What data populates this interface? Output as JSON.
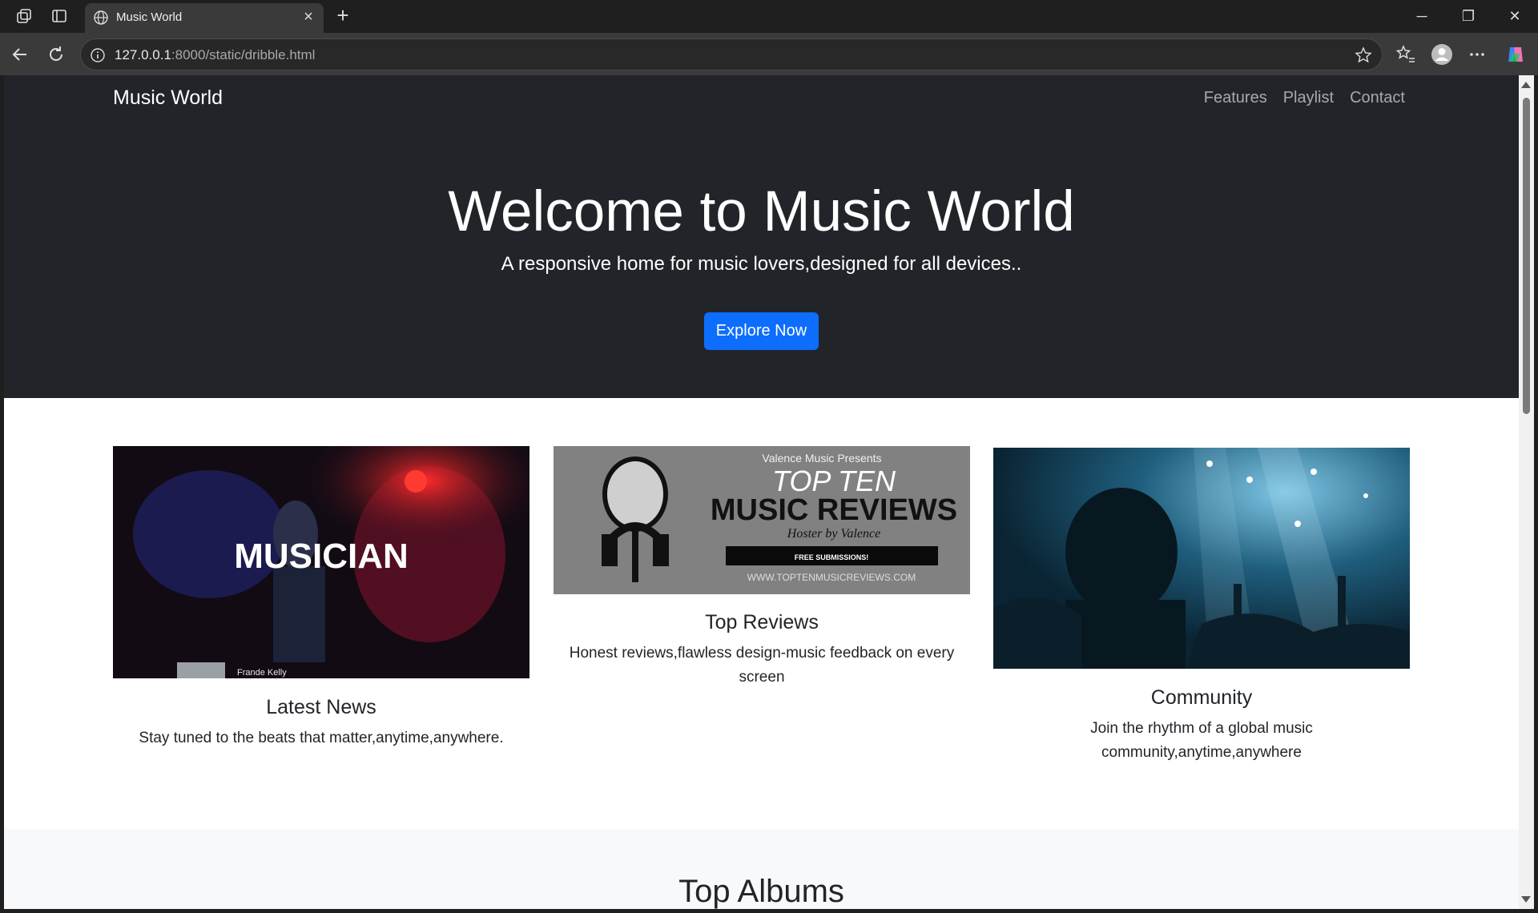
{
  "browser": {
    "tab_title": "Music World",
    "url_host": "127.0.0.1",
    "url_rest": ":8000/static/dribble.html"
  },
  "navbar": {
    "brand": "Music World",
    "links": [
      "Features",
      "Playlist",
      "Contact"
    ]
  },
  "hero": {
    "title": "Welcome to Music World",
    "subtitle": "A responsive home for music lovers,designed for all devices..",
    "cta": "Explore Now"
  },
  "cards": [
    {
      "title": "Latest News",
      "text": "Stay tuned to the beats that matter,anytime,anywhere.",
      "image_text": "MUSICIAN",
      "image_caption": "Frande Kelly"
    },
    {
      "title": "Top Reviews",
      "text": "Honest reviews,flawless design-music feedback on every screen",
      "image_presents": "Valence Music Presents",
      "image_line1": "TOP TEN",
      "image_line2": "MUSIC REVIEWS",
      "image_line3": "Hoster by Valence",
      "image_badge": "FREE SUBMISSIONS!",
      "image_url": "WWW.TOPTENMUSICREVIEWS.COM"
    },
    {
      "title": "Community",
      "text": "Join the rhythm of a global music community,anytime,anywhere"
    }
  ],
  "albums": {
    "title": "Top Albums"
  },
  "colors": {
    "hero_bg": "#212529",
    "primary": "#0d6efd",
    "light_bg": "#f8f9fa"
  }
}
